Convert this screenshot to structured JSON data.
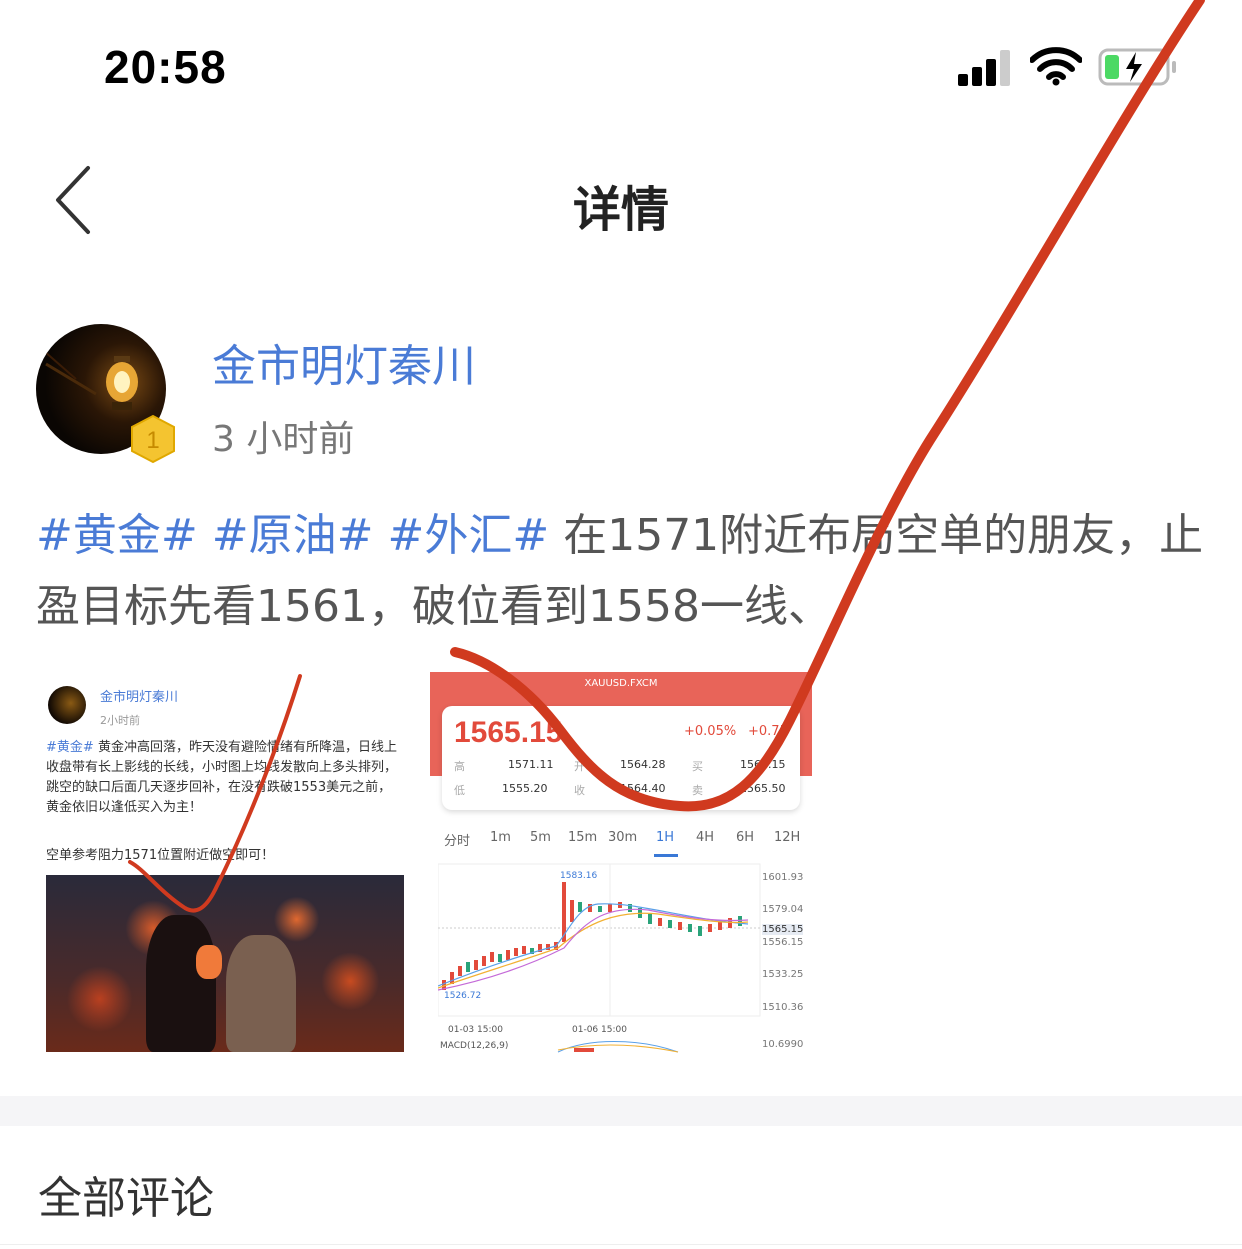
{
  "status_bar": {
    "time": "20:58",
    "icons": [
      "signal-icon",
      "wifi-icon",
      "battery-charging-icon"
    ]
  },
  "nav": {
    "back_icon": "chevron-left-icon",
    "title": "详情"
  },
  "author": {
    "name": "金市明灯秦川",
    "time": "3 小时前",
    "level": "1"
  },
  "post": {
    "tags": [
      "#黄金#",
      "#原油#",
      "#外汇#"
    ],
    "text": "在1571附近布局空单的朋友，止盈目标先看1561，破位看到1558一线、"
  },
  "attachment_post": {
    "author": "金市明灯秦川",
    "time": "2小时前",
    "tag": "#黄金#",
    "text": "黄金冲高回落，昨天没有避险情绪有所降温，日线上收盘带有长上影线的长线，小时图上均线发散向上多头排列，跳空的缺口后面几天逐步回补，在没有跌破1553美元之前，黄金依旧以逢低买入为主！",
    "extra": "空单参考阻力1571位置附近做空即可！"
  },
  "attachment_quote": {
    "symbol": "XAUUSD.FXCM",
    "price": "1565.15",
    "change_pct": "+0.05%",
    "change_abs": "+0.75",
    "labels": {
      "high": "高",
      "low": "低",
      "open": "开",
      "close": "收",
      "buy": "买",
      "sell": "卖"
    },
    "high": "1571.11",
    "low": "1555.20",
    "open": "1564.28",
    "close": "1564.40",
    "buy": "1565.15",
    "sell": "1565.50",
    "timeframes": [
      "分时",
      "1m",
      "5m",
      "15m",
      "30m",
      "1H",
      "4H",
      "6H",
      "12H"
    ],
    "active_timeframe": "1H",
    "y_axis": [
      "1601.93",
      "1579.04",
      "1565.15",
      "1556.15",
      "1533.25",
      "1510.36",
      "10.6990"
    ],
    "max_label": "1583.16",
    "min_label": "1526.72",
    "x_axis": [
      "01-03 15:00",
      "01-06 15:00"
    ],
    "macd_label": "MACD(12,26,9)"
  },
  "comments": {
    "title": "全部评论"
  },
  "colors": {
    "accent_blue": "#4a7bd6",
    "quote_red": "#e86459",
    "annotation_red": "#d03a1f"
  }
}
